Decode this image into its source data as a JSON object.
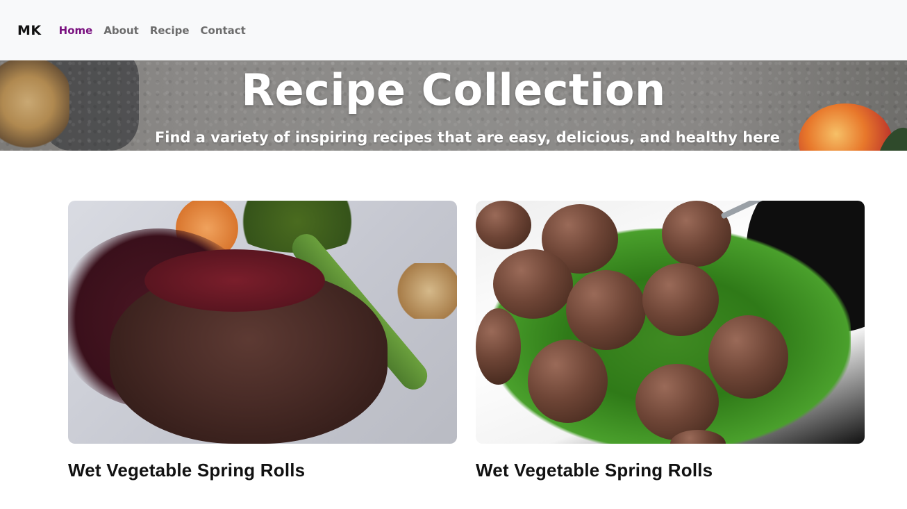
{
  "navbar": {
    "brand": "MK",
    "links": [
      {
        "label": "Home",
        "active": true
      },
      {
        "label": "About",
        "active": false
      },
      {
        "label": "Recipe",
        "active": false
      },
      {
        "label": "Contact",
        "active": false
      }
    ]
  },
  "hero": {
    "title": "Recipe Collection",
    "subtitle": "Find a variety of inspiring recipes that are easy, delicious, and healthy here"
  },
  "cards": [
    {
      "title": "Wet Vegetable Spring Rolls",
      "image": "steak-photo"
    },
    {
      "title": "Wet Vegetable Spring Rolls",
      "image": "meatballs-photo"
    }
  ],
  "colors": {
    "active_link": "#7a1280",
    "nav_link": "#6c6c6c",
    "navbar_bg": "#f8f9fa"
  }
}
